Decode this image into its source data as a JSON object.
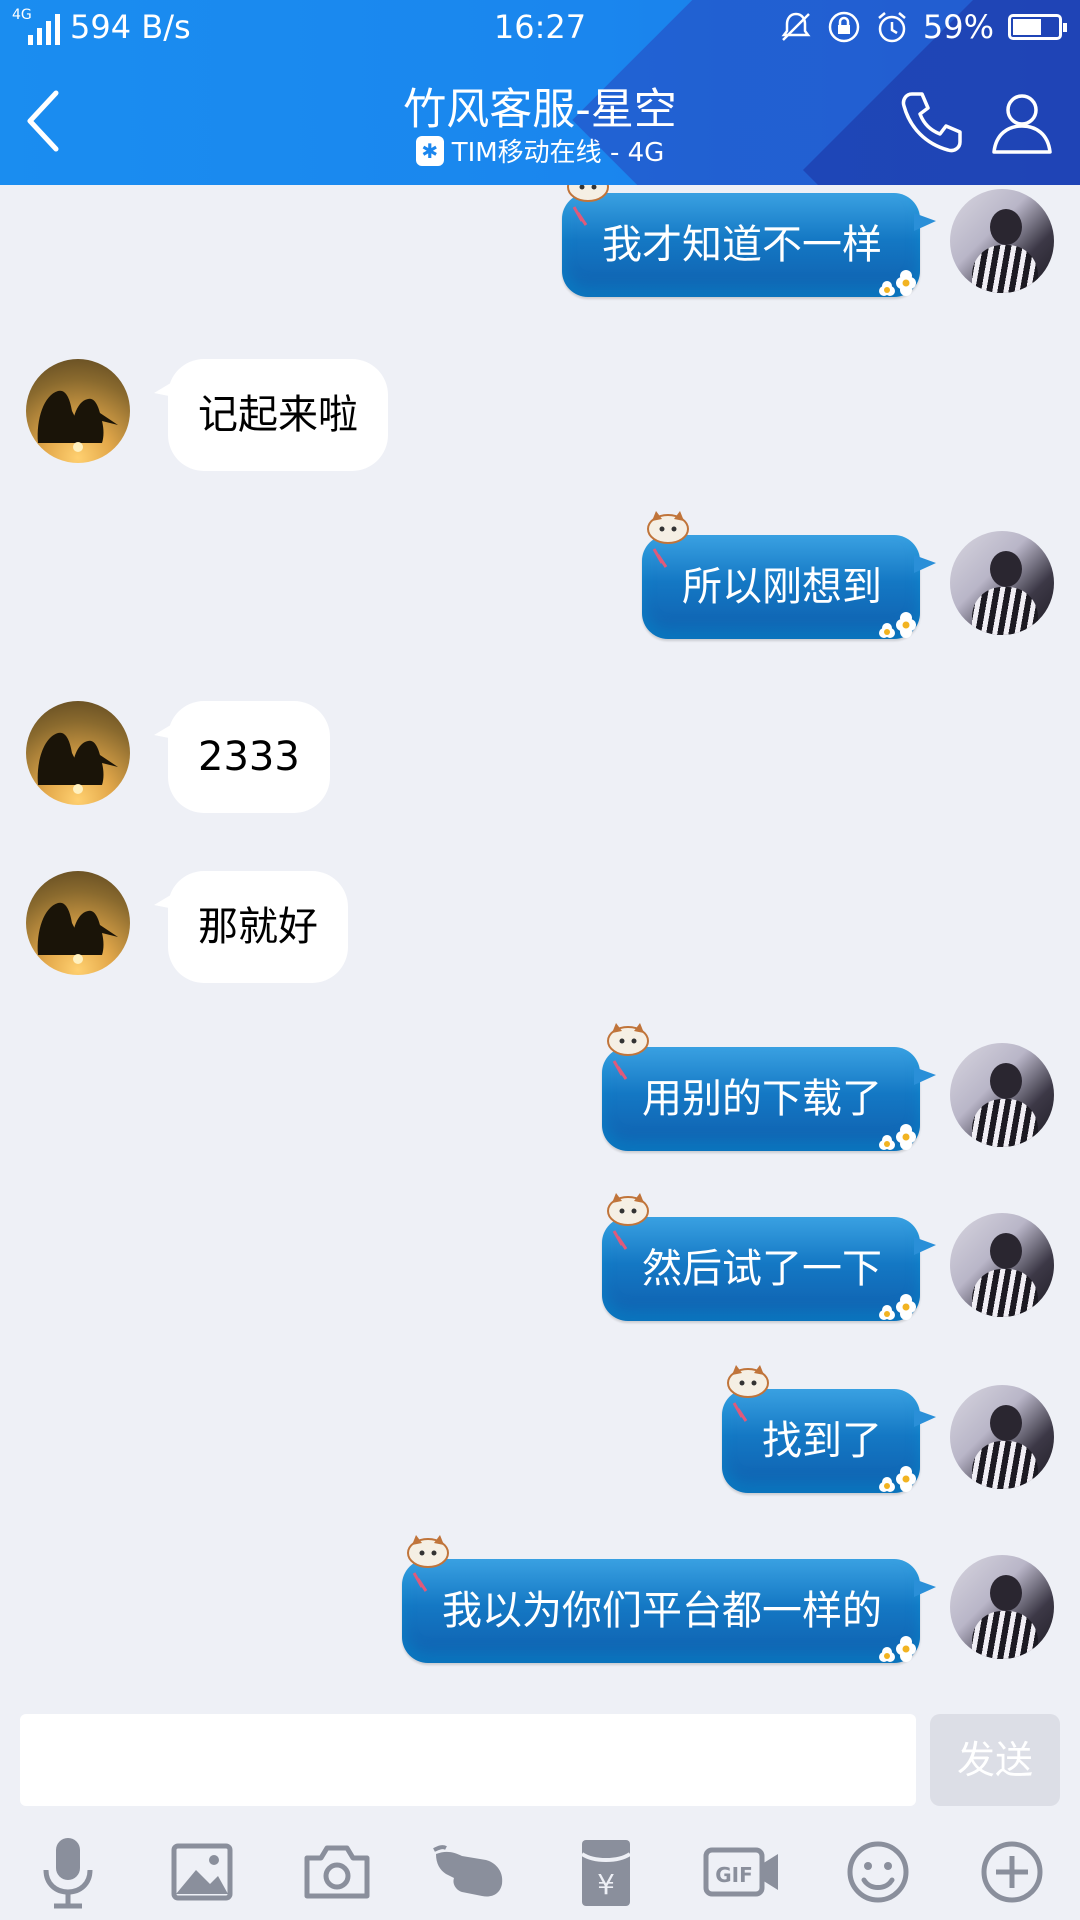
{
  "status_bar": {
    "network_tiny": "4G",
    "speed": "594 B/s",
    "time": "16:27",
    "battery": "59%"
  },
  "header": {
    "title": "竹风客服-星空",
    "subtitle": "TIM移动在线 - 4G"
  },
  "messages": [
    {
      "from": "self",
      "text": "我才知道不一样"
    },
    {
      "from": "other",
      "text": "记起来啦"
    },
    {
      "from": "self",
      "text": "所以刚想到"
    },
    {
      "from": "other",
      "text": "2333"
    },
    {
      "from": "other",
      "text": "那就好"
    },
    {
      "from": "self",
      "text": "用别的下载了"
    },
    {
      "from": "self",
      "text": "然后试了一下"
    },
    {
      "from": "self",
      "text": "找到了"
    },
    {
      "from": "self",
      "text": "我以为你们平台都一样的"
    }
  ],
  "input": {
    "placeholder": "",
    "send_label": "发送"
  },
  "toolbar": [
    "mic-icon",
    "image-icon",
    "camera-icon",
    "poke-icon",
    "red-packet-icon",
    "gif-icon",
    "emoji-icon",
    "plus-icon"
  ],
  "colors": {
    "header": "#1a86ee",
    "bubble_out": "#1478c4",
    "bubble_in": "#ffffff",
    "background": "#eef0f6"
  }
}
